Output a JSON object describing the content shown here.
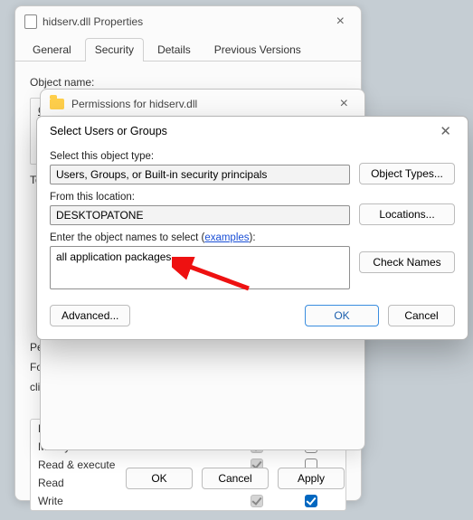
{
  "properties_window": {
    "title": "hidserv.dll Properties",
    "tabs": [
      "General",
      "Security",
      "Details",
      "Previous Versions"
    ],
    "active_tab_index": 1,
    "object_name_label": "Object name:",
    "group_label": "Gr",
    "to_label": "To",
    "permissions_caption": "Pe",
    "click_help_1": "For",
    "click_help_2": "click",
    "perm_table": {
      "rows": [
        {
          "label": "Full control",
          "allow": "grey",
          "deny": "empty"
        },
        {
          "label": "Modify",
          "allow": "grey",
          "deny": "empty"
        },
        {
          "label": "Read & execute",
          "allow": "grey",
          "deny": "empty"
        },
        {
          "label": "Read",
          "allow": "grey",
          "deny": "empty"
        },
        {
          "label": "Write",
          "allow": "grey",
          "deny": "blue"
        }
      ]
    },
    "buttons": {
      "ok": "OK",
      "cancel": "Cancel",
      "apply": "Apply"
    }
  },
  "permissions_window": {
    "title": "Permissions for hidserv.dll"
  },
  "select_dialog": {
    "title": "Select Users or Groups",
    "object_type_label": "Select this object type:",
    "object_type_value": "Users, Groups, or Built-in security principals",
    "object_types_btn": "Object Types...",
    "location_label": "From this location:",
    "location_value": "DESKTOPATONE",
    "locations_btn": "Locations...",
    "names_label_prefix": "Enter the object names to select (",
    "names_label_link": "examples",
    "names_label_suffix": "):",
    "names_value": "all application packages",
    "check_names_btn": "Check Names",
    "advanced_btn": "Advanced...",
    "ok": "OK",
    "cancel": "Cancel"
  }
}
